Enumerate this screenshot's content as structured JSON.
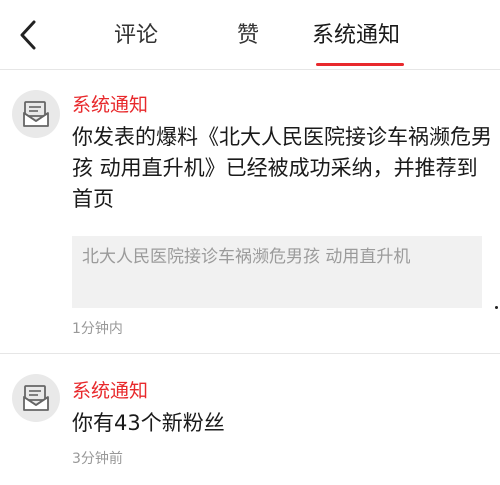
{
  "nav": {
    "back_icon": "chevron-left-icon",
    "tabs": [
      {
        "label": "评论",
        "active": false
      },
      {
        "label": "赞",
        "active": false
      },
      {
        "label": "系统通知",
        "active": true
      }
    ],
    "active_color": "#e8292c"
  },
  "notifications": [
    {
      "avatar_icon": "envelope-icon",
      "sender": "系统通知",
      "text": "你发表的爆料《北大人民医院接诊车祸濒危男孩 动用直升机》已经被成功采纳，并推荐到首页",
      "quote": "北大人民医院接诊车祸濒危男孩 动用直升机",
      "time": "1分钟内"
    },
    {
      "avatar_icon": "envelope-icon",
      "sender": "系统通知",
      "text": "你有43个新粉丝",
      "time": "3分钟前"
    }
  ],
  "colors": {
    "accent": "#e8292c",
    "divider": "#e6e6e6",
    "quote_bg": "#f1f1f1",
    "avatar_bg": "#e9e9e9"
  }
}
